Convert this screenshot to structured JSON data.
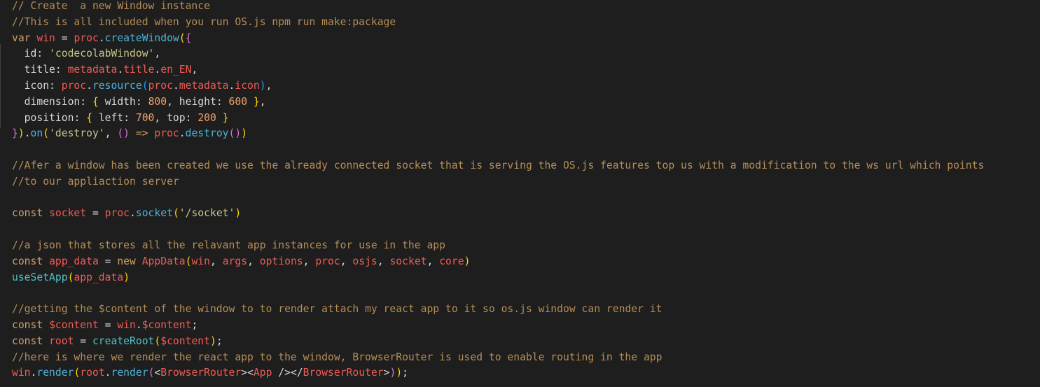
{
  "editor": {
    "lines": [
      [
        {
          "t": "// Create  a new Window instance",
          "c": "c"
        }
      ],
      [
        {
          "t": "//This is all included when you run OS.js npm run make:package",
          "c": "c"
        }
      ],
      [
        {
          "t": "var",
          "c": "k"
        },
        {
          "t": " ",
          "c": "o"
        },
        {
          "t": "win",
          "c": "v"
        },
        {
          "t": " = ",
          "c": "o"
        },
        {
          "t": "proc",
          "c": "v"
        },
        {
          "t": ".",
          "c": "o"
        },
        {
          "t": "createWindow",
          "c": "f"
        },
        {
          "t": "(",
          "c": "b1"
        },
        {
          "t": "{",
          "c": "b2"
        }
      ],
      [
        {
          "t": "  id",
          "c": "pr"
        },
        {
          "t": ": ",
          "c": "o"
        },
        {
          "t": "'codecolabWindow'",
          "c": "s"
        },
        {
          "t": ",",
          "c": "o"
        }
      ],
      [
        {
          "t": "  title",
          "c": "pr"
        },
        {
          "t": ": ",
          "c": "o"
        },
        {
          "t": "metadata",
          "c": "v"
        },
        {
          "t": ".",
          "c": "o"
        },
        {
          "t": "title",
          "c": "v"
        },
        {
          "t": ".",
          "c": "o"
        },
        {
          "t": "en_EN",
          "c": "v"
        },
        {
          "t": ",",
          "c": "o"
        }
      ],
      [
        {
          "t": "  icon",
          "c": "pr"
        },
        {
          "t": ": ",
          "c": "o"
        },
        {
          "t": "proc",
          "c": "v"
        },
        {
          "t": ".",
          "c": "o"
        },
        {
          "t": "resource",
          "c": "f"
        },
        {
          "t": "(",
          "c": "b3"
        },
        {
          "t": "proc",
          "c": "v"
        },
        {
          "t": ".",
          "c": "o"
        },
        {
          "t": "metadata",
          "c": "v"
        },
        {
          "t": ".",
          "c": "o"
        },
        {
          "t": "icon",
          "c": "v"
        },
        {
          "t": ")",
          "c": "b3"
        },
        {
          "t": ",",
          "c": "o"
        }
      ],
      [
        {
          "t": "  dimension",
          "c": "pr"
        },
        {
          "t": ": ",
          "c": "o"
        },
        {
          "t": "{",
          "c": "b1"
        },
        {
          "t": " width",
          "c": "pr"
        },
        {
          "t": ": ",
          "c": "o"
        },
        {
          "t": "800",
          "c": "n"
        },
        {
          "t": ", ",
          "c": "o"
        },
        {
          "t": "height",
          "c": "pr"
        },
        {
          "t": ": ",
          "c": "o"
        },
        {
          "t": "600",
          "c": "n"
        },
        {
          "t": " ",
          "c": "o"
        },
        {
          "t": "}",
          "c": "b1"
        },
        {
          "t": ",",
          "c": "o"
        }
      ],
      [
        {
          "t": "  position",
          "c": "pr"
        },
        {
          "t": ": ",
          "c": "o"
        },
        {
          "t": "{",
          "c": "b1"
        },
        {
          "t": " left",
          "c": "pr"
        },
        {
          "t": ": ",
          "c": "o"
        },
        {
          "t": "700",
          "c": "n"
        },
        {
          "t": ", ",
          "c": "o"
        },
        {
          "t": "top",
          "c": "pr"
        },
        {
          "t": ": ",
          "c": "o"
        },
        {
          "t": "200",
          "c": "n"
        },
        {
          "t": " ",
          "c": "o"
        },
        {
          "t": "}",
          "c": "b1"
        }
      ],
      [
        {
          "t": "}",
          "c": "b2"
        },
        {
          "t": ")",
          "c": "b1"
        },
        {
          "t": ".",
          "c": "o"
        },
        {
          "t": "on",
          "c": "f"
        },
        {
          "t": "(",
          "c": "b1"
        },
        {
          "t": "'destroy'",
          "c": "s"
        },
        {
          "t": ", ",
          "c": "o"
        },
        {
          "t": "()",
          "c": "b2"
        },
        {
          "t": " => ",
          "c": "k"
        },
        {
          "t": "proc",
          "c": "v"
        },
        {
          "t": ".",
          "c": "o"
        },
        {
          "t": "destroy",
          "c": "f"
        },
        {
          "t": "()",
          "c": "b2"
        },
        {
          "t": ")",
          "c": "b1"
        }
      ],
      [],
      [
        {
          "t": "//Afer a window has been created we use the already connected socket that is serving the OS.js features top us with a modification to the ws url which points",
          "c": "c"
        }
      ],
      [
        {
          "t": "//to our appliaction server",
          "c": "c"
        }
      ],
      [],
      [
        {
          "t": "const",
          "c": "k"
        },
        {
          "t": " ",
          "c": "o"
        },
        {
          "t": "socket",
          "c": "v"
        },
        {
          "t": " = ",
          "c": "o"
        },
        {
          "t": "proc",
          "c": "v"
        },
        {
          "t": ".",
          "c": "o"
        },
        {
          "t": "socket",
          "c": "f"
        },
        {
          "t": "(",
          "c": "b1"
        },
        {
          "t": "'/socket'",
          "c": "s"
        },
        {
          "t": ")",
          "c": "b1"
        }
      ],
      [],
      [
        {
          "t": "//a json that stores all the relavant app instances for use in the app",
          "c": "c"
        }
      ],
      [
        {
          "t": "const",
          "c": "k"
        },
        {
          "t": " ",
          "c": "o"
        },
        {
          "t": "app_data",
          "c": "v"
        },
        {
          "t": " = ",
          "c": "o"
        },
        {
          "t": "new",
          "c": "k"
        },
        {
          "t": " ",
          "c": "o"
        },
        {
          "t": "AppData",
          "c": "v"
        },
        {
          "t": "(",
          "c": "b1"
        },
        {
          "t": "win",
          "c": "v"
        },
        {
          "t": ", ",
          "c": "o"
        },
        {
          "t": "args",
          "c": "v"
        },
        {
          "t": ", ",
          "c": "o"
        },
        {
          "t": "options",
          "c": "v"
        },
        {
          "t": ", ",
          "c": "o"
        },
        {
          "t": "proc",
          "c": "v"
        },
        {
          "t": ", ",
          "c": "o"
        },
        {
          "t": "osjs",
          "c": "v"
        },
        {
          "t": ", ",
          "c": "o"
        },
        {
          "t": "socket",
          "c": "v"
        },
        {
          "t": ", ",
          "c": "o"
        },
        {
          "t": "core",
          "c": "v"
        },
        {
          "t": ")",
          "c": "b1"
        }
      ],
      [
        {
          "t": "useSetApp",
          "c": "j"
        },
        {
          "t": "(",
          "c": "b1"
        },
        {
          "t": "app_data",
          "c": "v"
        },
        {
          "t": ")",
          "c": "b1"
        }
      ],
      [],
      [
        {
          "t": "//getting the $content of the window to to render attach my react app to it so os.js window can render it",
          "c": "c"
        }
      ],
      [
        {
          "t": "const",
          "c": "k"
        },
        {
          "t": " ",
          "c": "o"
        },
        {
          "t": "$content",
          "c": "v"
        },
        {
          "t": " = ",
          "c": "o"
        },
        {
          "t": "win",
          "c": "v"
        },
        {
          "t": ".",
          "c": "o"
        },
        {
          "t": "$content",
          "c": "v"
        },
        {
          "t": ";",
          "c": "o"
        }
      ],
      [
        {
          "t": "const",
          "c": "k"
        },
        {
          "t": " ",
          "c": "o"
        },
        {
          "t": "root",
          "c": "v"
        },
        {
          "t": " = ",
          "c": "o"
        },
        {
          "t": "createRoot",
          "c": "j"
        },
        {
          "t": "(",
          "c": "b1"
        },
        {
          "t": "$content",
          "c": "v"
        },
        {
          "t": ")",
          "c": "b1"
        },
        {
          "t": ";",
          "c": "o"
        }
      ],
      [
        {
          "t": "//here is where we render the react app to the window, BrowserRouter is used to enable routing in the app",
          "c": "c"
        }
      ],
      [
        {
          "t": "win",
          "c": "v"
        },
        {
          "t": ".",
          "c": "o"
        },
        {
          "t": "render",
          "c": "f"
        },
        {
          "t": "(",
          "c": "b1"
        },
        {
          "t": "root",
          "c": "v"
        },
        {
          "t": ".",
          "c": "o"
        },
        {
          "t": "render",
          "c": "f"
        },
        {
          "t": "(",
          "c": "b2"
        },
        {
          "t": "<",
          "c": "o"
        },
        {
          "t": "BrowserRouter",
          "c": "t"
        },
        {
          "t": ">",
          "c": "o"
        },
        {
          "t": "<",
          "c": "o"
        },
        {
          "t": "App",
          "c": "t"
        },
        {
          "t": " />",
          "c": "o"
        },
        {
          "t": "</",
          "c": "o"
        },
        {
          "t": "BrowserRouter",
          "c": "t"
        },
        {
          "t": ">",
          "c": "o"
        },
        {
          "t": ")",
          "c": "b2"
        },
        {
          "t": ")",
          "c": "b1"
        },
        {
          "t": ";",
          "c": "o"
        }
      ]
    ]
  }
}
